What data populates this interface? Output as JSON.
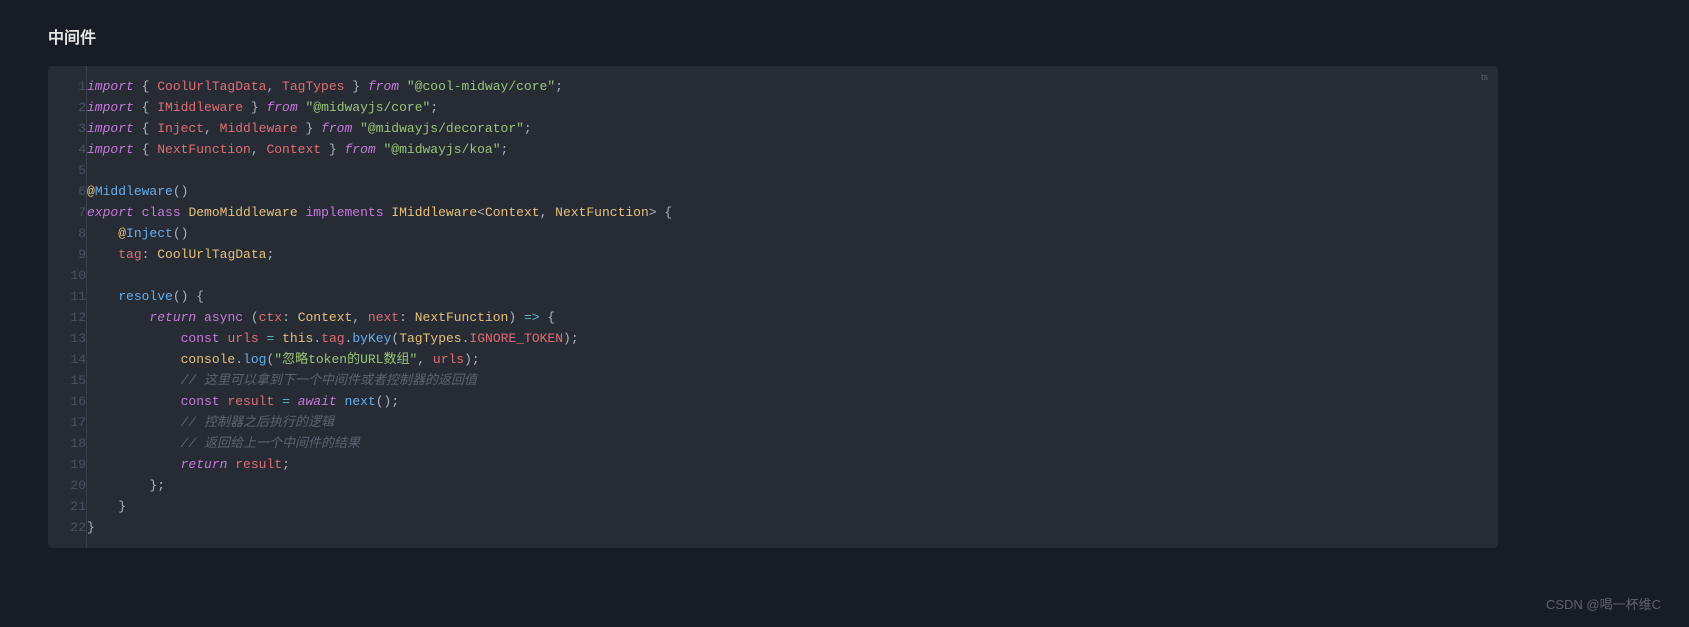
{
  "title": "中间件",
  "language_tag": "ts",
  "footer": "CSDN @喝一杯维C",
  "lines": [
    {
      "n": 1,
      "tokens": [
        {
          "t": "import",
          "c": "kw-it"
        },
        {
          "t": " { ",
          "c": "pn"
        },
        {
          "t": "CoolUrlTagData",
          "c": "var"
        },
        {
          "t": ", ",
          "c": "pn"
        },
        {
          "t": "TagTypes",
          "c": "var"
        },
        {
          "t": " } ",
          "c": "pn"
        },
        {
          "t": "from",
          "c": "kw-it"
        },
        {
          "t": " ",
          "c": "pn"
        },
        {
          "t": "\"@cool-midway/core\"",
          "c": "str"
        },
        {
          "t": ";",
          "c": "pn"
        }
      ]
    },
    {
      "n": 2,
      "tokens": [
        {
          "t": "import",
          "c": "kw-it"
        },
        {
          "t": " { ",
          "c": "pn"
        },
        {
          "t": "IMiddleware",
          "c": "var"
        },
        {
          "t": " } ",
          "c": "pn"
        },
        {
          "t": "from",
          "c": "kw-it"
        },
        {
          "t": " ",
          "c": "pn"
        },
        {
          "t": "\"@midwayjs/core\"",
          "c": "str"
        },
        {
          "t": ";",
          "c": "pn"
        }
      ]
    },
    {
      "n": 3,
      "tokens": [
        {
          "t": "import",
          "c": "kw-it"
        },
        {
          "t": " { ",
          "c": "pn"
        },
        {
          "t": "Inject",
          "c": "var"
        },
        {
          "t": ", ",
          "c": "pn"
        },
        {
          "t": "Middleware",
          "c": "var"
        },
        {
          "t": " } ",
          "c": "pn"
        },
        {
          "t": "from",
          "c": "kw-it"
        },
        {
          "t": " ",
          "c": "pn"
        },
        {
          "t": "\"@midwayjs/decorator\"",
          "c": "str"
        },
        {
          "t": ";",
          "c": "pn"
        }
      ]
    },
    {
      "n": 4,
      "tokens": [
        {
          "t": "import",
          "c": "kw-it"
        },
        {
          "t": " { ",
          "c": "pn"
        },
        {
          "t": "NextFunction",
          "c": "var"
        },
        {
          "t": ", ",
          "c": "pn"
        },
        {
          "t": "Context",
          "c": "var"
        },
        {
          "t": " } ",
          "c": "pn"
        },
        {
          "t": "from",
          "c": "kw-it"
        },
        {
          "t": " ",
          "c": "pn"
        },
        {
          "t": "\"@midwayjs/koa\"",
          "c": "str"
        },
        {
          "t": ";",
          "c": "pn"
        }
      ]
    },
    {
      "n": 5,
      "tokens": [
        {
          "t": "",
          "c": "pn"
        }
      ]
    },
    {
      "n": 6,
      "tokens": [
        {
          "t": "@",
          "c": "dec"
        },
        {
          "t": "Middleware",
          "c": "fn"
        },
        {
          "t": "()",
          "c": "pn"
        }
      ]
    },
    {
      "n": 7,
      "tokens": [
        {
          "t": "export",
          "c": "kw-it"
        },
        {
          "t": " ",
          "c": "pn"
        },
        {
          "t": "class",
          "c": "kw"
        },
        {
          "t": " ",
          "c": "pn"
        },
        {
          "t": "DemoMiddleware",
          "c": "cls"
        },
        {
          "t": " ",
          "c": "pn"
        },
        {
          "t": "implements",
          "c": "kw"
        },
        {
          "t": " ",
          "c": "pn"
        },
        {
          "t": "IMiddleware",
          "c": "cls"
        },
        {
          "t": "<",
          "c": "pn"
        },
        {
          "t": "Context",
          "c": "cls"
        },
        {
          "t": ", ",
          "c": "pn"
        },
        {
          "t": "NextFunction",
          "c": "cls"
        },
        {
          "t": "> {",
          "c": "pn"
        }
      ]
    },
    {
      "n": 8,
      "tokens": [
        {
          "t": "    ",
          "c": "pn"
        },
        {
          "t": "@",
          "c": "dec"
        },
        {
          "t": "Inject",
          "c": "fn"
        },
        {
          "t": "()",
          "c": "pn"
        }
      ]
    },
    {
      "n": 9,
      "tokens": [
        {
          "t": "    ",
          "c": "pn"
        },
        {
          "t": "tag",
          "c": "prop"
        },
        {
          "t": ": ",
          "c": "pn"
        },
        {
          "t": "CoolUrlTagData",
          "c": "cls"
        },
        {
          "t": ";",
          "c": "pn"
        }
      ]
    },
    {
      "n": 10,
      "tokens": [
        {
          "t": "",
          "c": "pn"
        }
      ]
    },
    {
      "n": 11,
      "tokens": [
        {
          "t": "    ",
          "c": "pn"
        },
        {
          "t": "resolve",
          "c": "fn"
        },
        {
          "t": "() {",
          "c": "pn"
        }
      ]
    },
    {
      "n": 12,
      "tokens": [
        {
          "t": "        ",
          "c": "pn"
        },
        {
          "t": "return",
          "c": "kw-it"
        },
        {
          "t": " ",
          "c": "pn"
        },
        {
          "t": "async",
          "c": "kw"
        },
        {
          "t": " (",
          "c": "pn"
        },
        {
          "t": "ctx",
          "c": "var"
        },
        {
          "t": ": ",
          "c": "pn"
        },
        {
          "t": "Context",
          "c": "cls"
        },
        {
          "t": ", ",
          "c": "pn"
        },
        {
          "t": "next",
          "c": "var"
        },
        {
          "t": ": ",
          "c": "pn"
        },
        {
          "t": "NextFunction",
          "c": "cls"
        },
        {
          "t": ") ",
          "c": "pn"
        },
        {
          "t": "=>",
          "c": "op"
        },
        {
          "t": " {",
          "c": "pn"
        }
      ]
    },
    {
      "n": 13,
      "tokens": [
        {
          "t": "            ",
          "c": "pn"
        },
        {
          "t": "const",
          "c": "kw"
        },
        {
          "t": " ",
          "c": "pn"
        },
        {
          "t": "urls",
          "c": "var"
        },
        {
          "t": " ",
          "c": "pn"
        },
        {
          "t": "=",
          "c": "op"
        },
        {
          "t": " ",
          "c": "pn"
        },
        {
          "t": "this",
          "c": "thiskw"
        },
        {
          "t": ".",
          "c": "pn"
        },
        {
          "t": "tag",
          "c": "prop"
        },
        {
          "t": ".",
          "c": "pn"
        },
        {
          "t": "byKey",
          "c": "fn"
        },
        {
          "t": "(",
          "c": "pn"
        },
        {
          "t": "TagTypes",
          "c": "cls"
        },
        {
          "t": ".",
          "c": "pn"
        },
        {
          "t": "IGNORE_TOKEN",
          "c": "var"
        },
        {
          "t": ");",
          "c": "pn"
        }
      ]
    },
    {
      "n": 14,
      "tokens": [
        {
          "t": "            ",
          "c": "pn"
        },
        {
          "t": "console",
          "c": "cls"
        },
        {
          "t": ".",
          "c": "pn"
        },
        {
          "t": "log",
          "c": "fn"
        },
        {
          "t": "(",
          "c": "pn"
        },
        {
          "t": "\"忽略token的URL数组\"",
          "c": "str"
        },
        {
          "t": ", ",
          "c": "pn"
        },
        {
          "t": "urls",
          "c": "var"
        },
        {
          "t": ");",
          "c": "pn"
        }
      ]
    },
    {
      "n": 15,
      "tokens": [
        {
          "t": "            ",
          "c": "pn"
        },
        {
          "t": "// 这里可以拿到下一个中间件或者控制器的返回值",
          "c": "cmt"
        }
      ]
    },
    {
      "n": 16,
      "tokens": [
        {
          "t": "            ",
          "c": "pn"
        },
        {
          "t": "const",
          "c": "kw"
        },
        {
          "t": " ",
          "c": "pn"
        },
        {
          "t": "result",
          "c": "var"
        },
        {
          "t": " ",
          "c": "pn"
        },
        {
          "t": "=",
          "c": "op"
        },
        {
          "t": " ",
          "c": "pn"
        },
        {
          "t": "await",
          "c": "kw-it"
        },
        {
          "t": " ",
          "c": "pn"
        },
        {
          "t": "next",
          "c": "fn"
        },
        {
          "t": "();",
          "c": "pn"
        }
      ]
    },
    {
      "n": 17,
      "tokens": [
        {
          "t": "            ",
          "c": "pn"
        },
        {
          "t": "// 控制器之后执行的逻辑",
          "c": "cmt"
        }
      ]
    },
    {
      "n": 18,
      "tokens": [
        {
          "t": "            ",
          "c": "pn"
        },
        {
          "t": "// 返回给上一个中间件的结果",
          "c": "cmt"
        }
      ]
    },
    {
      "n": 19,
      "tokens": [
        {
          "t": "            ",
          "c": "pn"
        },
        {
          "t": "return",
          "c": "kw-it"
        },
        {
          "t": " ",
          "c": "pn"
        },
        {
          "t": "result",
          "c": "var"
        },
        {
          "t": ";",
          "c": "pn"
        }
      ]
    },
    {
      "n": 20,
      "tokens": [
        {
          "t": "        };",
          "c": "pn"
        }
      ]
    },
    {
      "n": 21,
      "tokens": [
        {
          "t": "    }",
          "c": "pn"
        }
      ]
    },
    {
      "n": 22,
      "tokens": [
        {
          "t": "}",
          "c": "pn"
        }
      ]
    }
  ]
}
